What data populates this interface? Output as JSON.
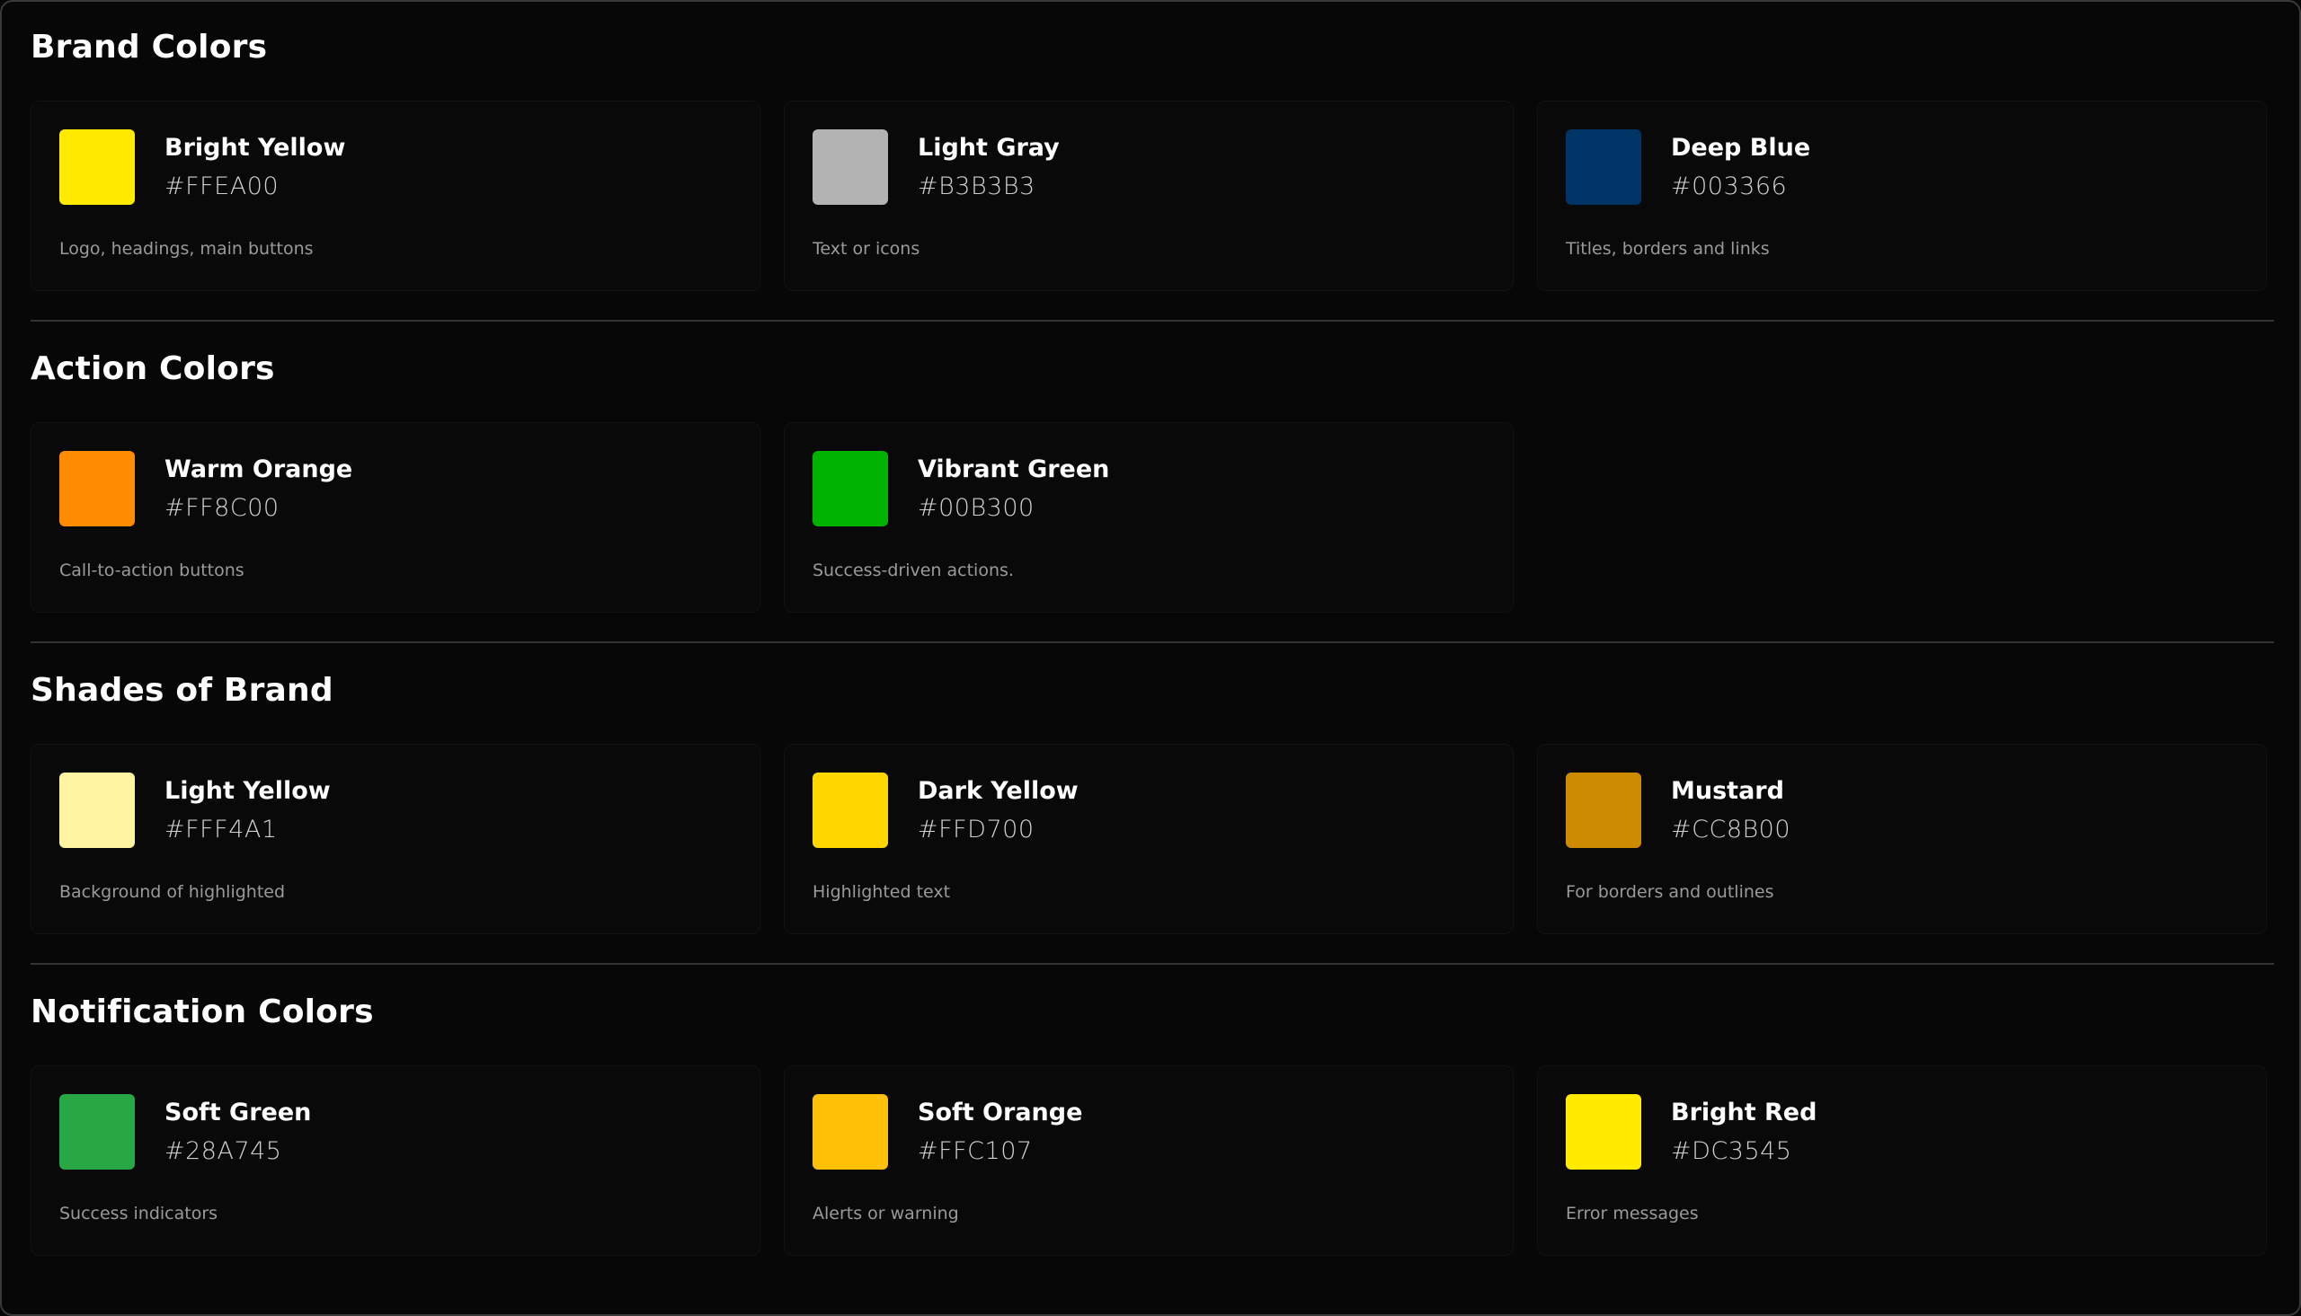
{
  "sections": [
    {
      "title": "Brand Colors",
      "cards": [
        {
          "name": "Bright Yellow",
          "hex": "#FFEA00",
          "description": "Logo, headings, main buttons",
          "swatch": "#FFEA00"
        },
        {
          "name": "Light Gray",
          "hex": "#B3B3B3",
          "description": "Text or icons",
          "swatch": "#B3B3B3"
        },
        {
          "name": "Deep Blue",
          "hex": "#003366",
          "description": "Titles, borders and links",
          "swatch": "#003366"
        }
      ]
    },
    {
      "title": "Action Colors",
      "cards": [
        {
          "name": "Warm Orange",
          "hex": "#FF8C00",
          "description": "Call-to-action buttons",
          "swatch": "#FF8C00"
        },
        {
          "name": "Vibrant Green",
          "hex": "#00B300",
          "description": "Success-driven actions.",
          "swatch": "#00B300"
        }
      ]
    },
    {
      "title": "Shades of Brand",
      "cards": [
        {
          "name": "Light Yellow",
          "hex": "#FFF4A1",
          "description": "Background of highlighted",
          "swatch": "#FFF4A1"
        },
        {
          "name": "Dark Yellow",
          "hex": "#FFD700",
          "description": "Highlighted text",
          "swatch": "#FFD700"
        },
        {
          "name": "Mustard",
          "hex": "#CC8B00",
          "description": "For borders and outlines",
          "swatch": "#CC8B00"
        }
      ]
    },
    {
      "title": "Notification Colors",
      "cards": [
        {
          "name": "Soft Green",
          "hex": "#28A745",
          "description": "Success indicators",
          "swatch": "#28A745"
        },
        {
          "name": "Soft Orange",
          "hex": "#FFC107",
          "description": "Alerts or warning",
          "swatch": "#FFC107"
        },
        {
          "name": "Bright Red",
          "hex": "#DC3545",
          "description": "Error messages",
          "swatch": "#FFEA00"
        }
      ]
    }
  ]
}
